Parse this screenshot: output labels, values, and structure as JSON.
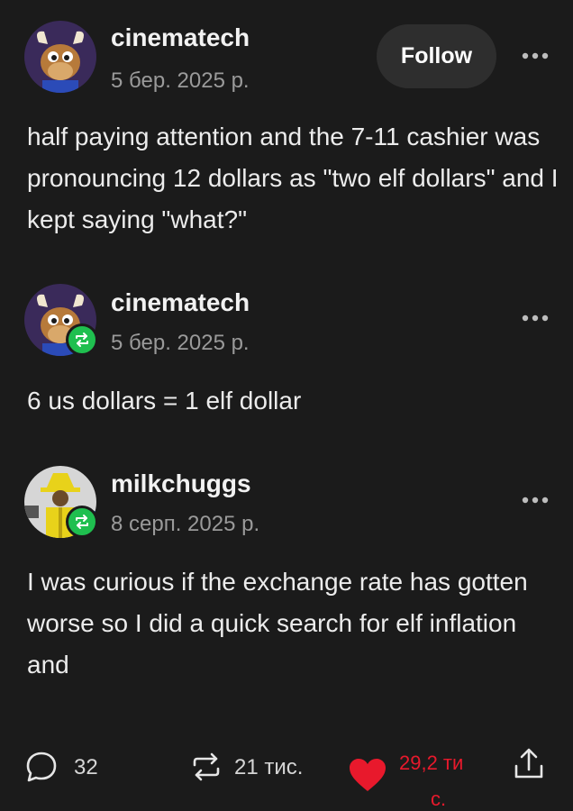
{
  "follow_label": "Follow",
  "posts": [
    {
      "username": "cinematech",
      "date": "5 бер. 2025 р.",
      "text": "half paying attention and the 7-11 cashier was pronouncing 12 dollars as \"two elf dollars\" and I kept saying \"what?\""
    },
    {
      "username": "cinematech",
      "date": "5 бер. 2025 р.",
      "text": "6 us dollars = 1 elf dollar"
    },
    {
      "username": "milkchuggs",
      "date": "8 серп. 2025 р.",
      "text": "I was curious if the exchange rate has gotten worse so I did a quick search for elf inflation and"
    }
  ],
  "actions": {
    "replies": "32",
    "reblogs": "21 тис.",
    "likes_line1": "29,2 ти",
    "likes_line2": "с."
  },
  "colors": {
    "background": "#1b1b1b",
    "reblog_green": "#1fbf4f",
    "like_red": "#e8192c",
    "muted_text": "#9a9a9a"
  },
  "icons": [
    "more-icon",
    "reblog-icon",
    "reply-icon",
    "heart-icon",
    "share-icon"
  ]
}
